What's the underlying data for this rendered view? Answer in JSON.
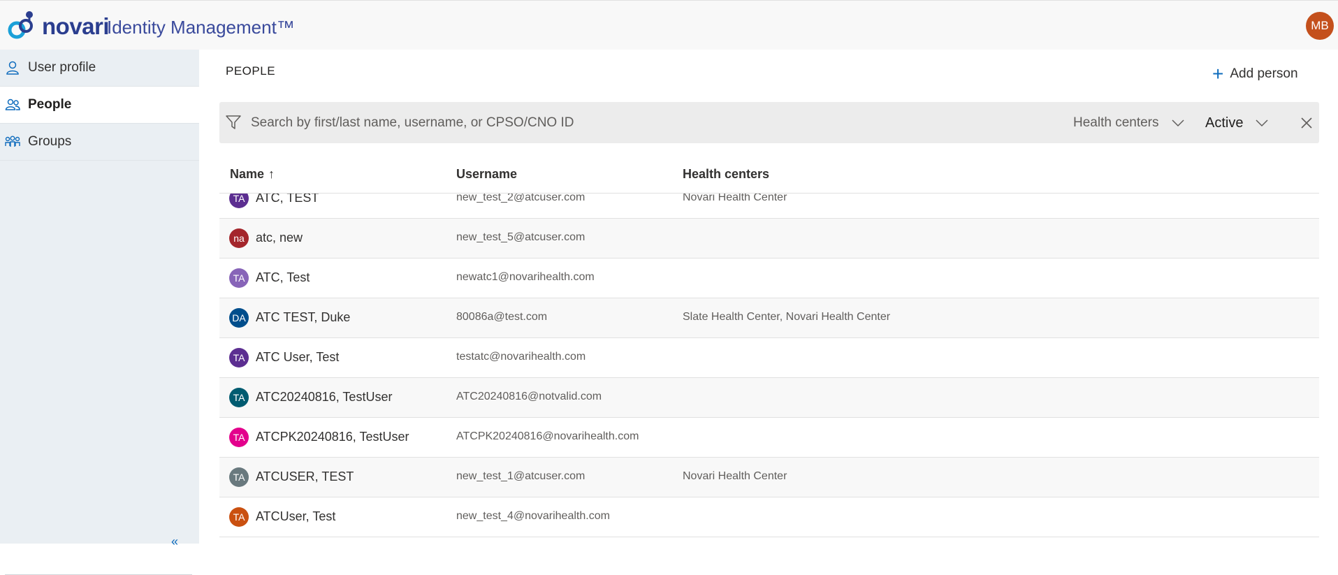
{
  "header": {
    "brand": "novari",
    "product": "Identity Management™",
    "user_initials": "MB",
    "colors": {
      "brand": "#2b3e8f",
      "avatar": "#c4501c",
      "accent": "#0f6cbd"
    }
  },
  "sidebar": {
    "items": [
      {
        "label": "User profile",
        "icon": "person-icon",
        "active": false
      },
      {
        "label": "People",
        "icon": "people-icon",
        "active": true
      },
      {
        "label": "Groups",
        "icon": "groups-icon",
        "active": false
      }
    ],
    "collapse_glyph": "«"
  },
  "main": {
    "title": "PEOPLE",
    "add_button": {
      "icon": "plus-icon",
      "label": "Add person"
    }
  },
  "filters": {
    "search_placeholder": "Search by first/last name, username, or CPSO/CNO ID",
    "search_value": "",
    "health_centers_label": "Health centers",
    "status_label": "Active"
  },
  "table": {
    "columns": {
      "name": "Name",
      "sort_glyph": "↑",
      "username": "Username",
      "health_centers": "Health centers"
    },
    "rows": [
      {
        "initials": "TA",
        "color": "#5c2e91",
        "name": "ATC, TEST",
        "username": "new_test_2@atcuser.com",
        "health_centers": "Novari Health Center"
      },
      {
        "initials": "na",
        "color": "#a4262c",
        "name": "atc, new",
        "username": "new_test_5@atcuser.com",
        "health_centers": ""
      },
      {
        "initials": "TA",
        "color": "#8764b8",
        "name": "ATC, Test",
        "username": "newatc1@novarihealth.com",
        "health_centers": ""
      },
      {
        "initials": "DA",
        "color": "#004e8c",
        "name": "ATC TEST, Duke",
        "username": "80086a@test.com",
        "health_centers": "Slate Health Center, Novari Health Center"
      },
      {
        "initials": "TA",
        "color": "#5c2e91",
        "name": "ATC User, Test",
        "username": "testatc@novarihealth.com",
        "health_centers": ""
      },
      {
        "initials": "TA",
        "color": "#005b70",
        "name": "ATC20240816, TestUser",
        "username": "ATC20240816@notvalid.com",
        "health_centers": ""
      },
      {
        "initials": "TA",
        "color": "#e3008c",
        "name": "ATCPK20240816, TestUser",
        "username": "ATCPK20240816@novarihealth.com",
        "health_centers": ""
      },
      {
        "initials": "TA",
        "color": "#69797e",
        "name": "ATCUSER, TEST",
        "username": "new_test_1@atcuser.com",
        "health_centers": "Novari Health Center"
      },
      {
        "initials": "TA",
        "color": "#ca5010",
        "name": "ATCUser, Test",
        "username": "new_test_4@novarihealth.com",
        "health_centers": ""
      }
    ]
  }
}
